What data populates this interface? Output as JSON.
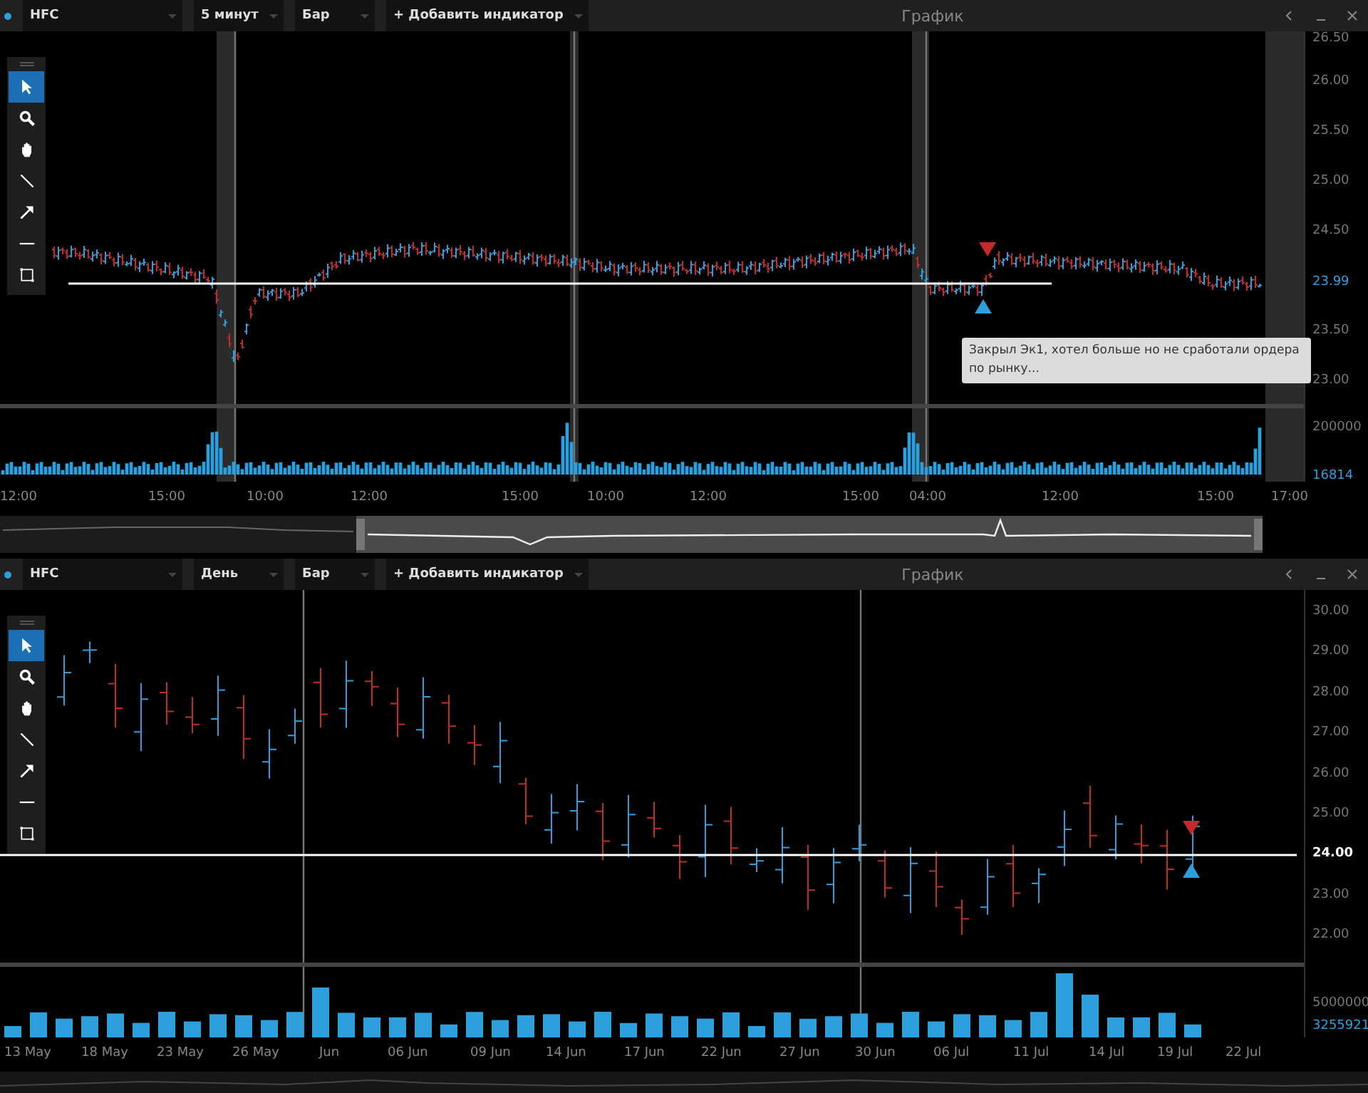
{
  "panels": [
    {
      "toolbar": {
        "symbol": "HFC",
        "interval": "5 минут",
        "chart_type": "Бар",
        "add_indicator": "+ Добавить индикатор",
        "title": "График"
      },
      "tools": [
        {
          "kind": "cursor",
          "selected": true
        },
        {
          "kind": "zoom",
          "selected": false
        },
        {
          "kind": "pan",
          "selected": false
        },
        {
          "kind": "line",
          "selected": false
        },
        {
          "kind": "arrow",
          "selected": false
        },
        {
          "kind": "hline",
          "selected": false
        },
        {
          "kind": "rect",
          "selected": false
        }
      ],
      "price_axis": [
        "26.50",
        "26.00",
        "25.50",
        "25.00",
        "24.50",
        "23.50",
        "23.00"
      ],
      "price_marker": "23.99",
      "volume_axis": [
        "200000"
      ],
      "volume_marker": "16814",
      "time_axis": [
        "12:00",
        "15:00",
        "10:00",
        "12:00",
        "15:00",
        "10:00",
        "12:00",
        "15:00",
        "04:00",
        "12:00",
        "15:00",
        "17:00"
      ],
      "note": "Закрыл Эк1, хотел больше но не сработали ордера по рынку..."
    },
    {
      "toolbar": {
        "symbol": "HFC",
        "interval": "День",
        "chart_type": "Бар",
        "add_indicator": "+ Добавить индикатор",
        "title": "График"
      },
      "tools": [
        {
          "kind": "cursor",
          "selected": true
        },
        {
          "kind": "zoom",
          "selected": false
        },
        {
          "kind": "pan",
          "selected": false
        },
        {
          "kind": "line",
          "selected": false
        },
        {
          "kind": "arrow",
          "selected": false
        },
        {
          "kind": "hline",
          "selected": false
        },
        {
          "kind": "rect",
          "selected": false
        }
      ],
      "price_axis": [
        "30.00",
        "29.00",
        "28.00",
        "27.00",
        "26.00",
        "25.00",
        "23.00",
        "22.00"
      ],
      "price_marker": "24.00",
      "volume_axis": [
        "5000000"
      ],
      "volume_marker": "3255921",
      "time_axis": [
        "13 May",
        "18 May",
        "23 May",
        "26 May",
        "Jun",
        "06 Jun",
        "09 Jun",
        "14 Jun",
        "17 Jun",
        "22 Jun",
        "27 Jun",
        "30 Jun",
        "06 Jul",
        "11 Jul",
        "14 Jul",
        "19 Jul",
        "22 Jul"
      ]
    }
  ]
}
